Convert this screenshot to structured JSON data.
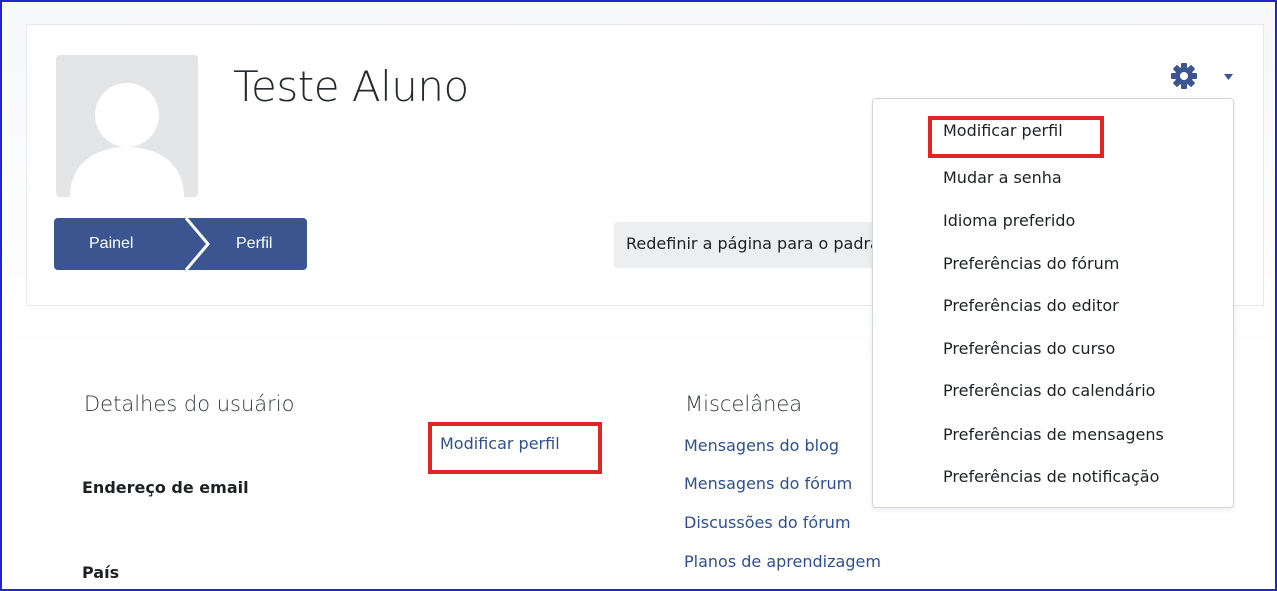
{
  "profile": {
    "name": "Teste Aluno"
  },
  "breadcrumb": {
    "items": [
      "Painel",
      "Perfil"
    ]
  },
  "reset_button": {
    "label": "Redefinir a página para o padrão"
  },
  "settings_menu": {
    "icon": "gear-icon",
    "items": [
      "Modificar perfil",
      "Mudar a senha",
      "Idioma preferido",
      "Preferências do fórum",
      "Preferências do editor",
      "Preferências do curso",
      "Preferências do calendário",
      "Preferências de mensagens",
      "Preferências de notificação"
    ]
  },
  "user_details": {
    "title": "Detalhes do usuário",
    "edit_link": "Modificar perfil",
    "fields": [
      "Endereço de email",
      "País"
    ]
  },
  "miscellaneous": {
    "title": "Miscelânea",
    "links": [
      "Mensagens do blog",
      "Mensagens do fórum",
      "Discussões do fórum",
      "Planos de aprendizagem"
    ]
  },
  "colors": {
    "breadcrumb_bg": "#3a5590",
    "link": "#2f4f8f",
    "highlight": "#e02525"
  }
}
